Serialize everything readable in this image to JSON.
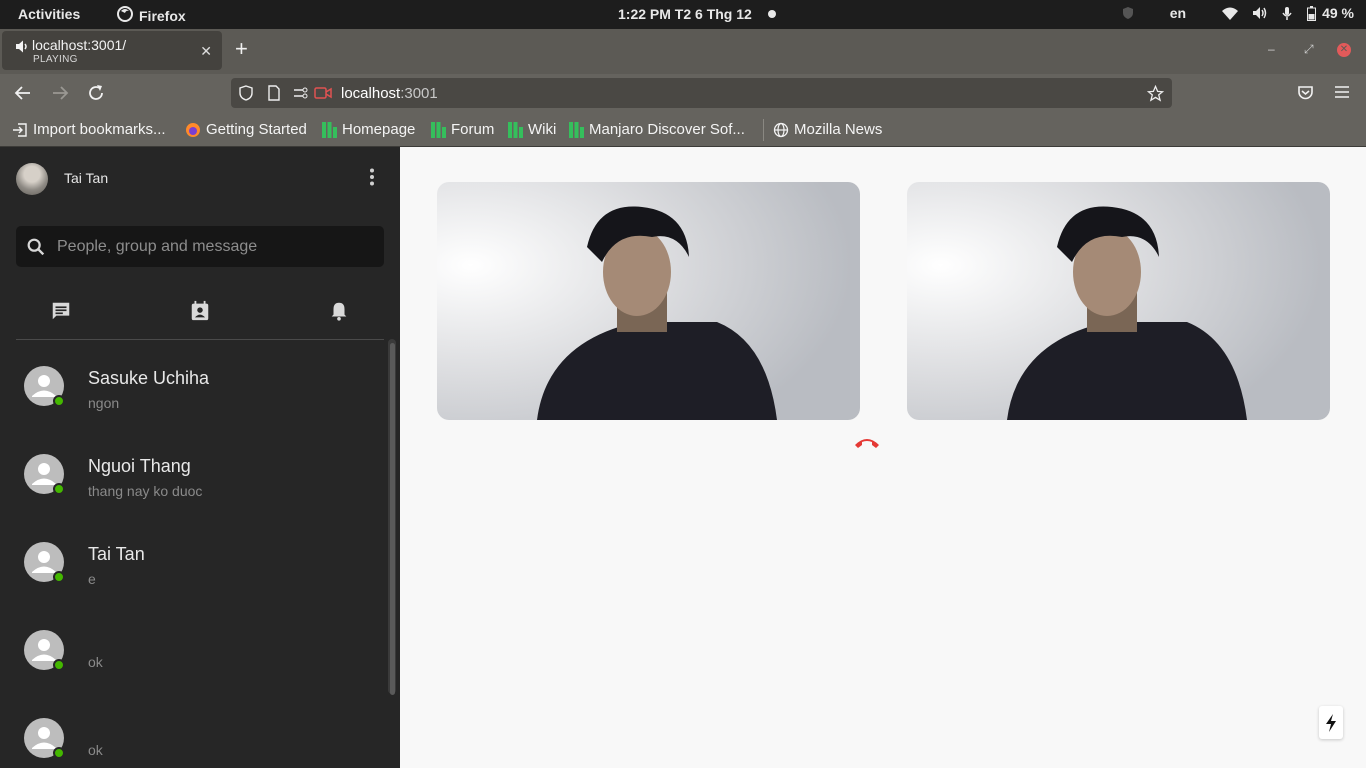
{
  "system_bar": {
    "activities": "Activities",
    "app_name": "Firefox",
    "clock": "1:22 PM  T2 6 Thg 12",
    "language": "en",
    "battery": "49 %"
  },
  "browser": {
    "tab": {
      "title": "localhost:3001/",
      "status": "PLAYING"
    },
    "url_host": "localhost",
    "url_port": ":3001",
    "bookmarks": [
      {
        "label": "Import bookmarks...",
        "icon": "import-icon"
      },
      {
        "label": "Getting Started",
        "icon": "firefox-icon"
      },
      {
        "label": "Homepage",
        "icon": "manjaro-icon"
      },
      {
        "label": "Forum",
        "icon": "manjaro-icon"
      },
      {
        "label": "Wiki",
        "icon": "manjaro-icon"
      },
      {
        "label": "Manjaro Discover Sof...",
        "icon": "manjaro-icon"
      },
      {
        "label": "Mozilla News",
        "icon": "globe-icon"
      }
    ]
  },
  "sidebar": {
    "user_name": "Tai Tan",
    "search_placeholder": "People, group and message",
    "tabs": [
      "chat-icon",
      "contacts-icon",
      "bell-icon"
    ],
    "conversations": [
      {
        "name": "Sasuke Uchiha",
        "last_message": "ngon"
      },
      {
        "name": "Nguoi Thang",
        "last_message": "thang nay ko duoc"
      },
      {
        "name": "Tai Tan",
        "last_message": "e"
      },
      {
        "name": "",
        "last_message": "ok"
      },
      {
        "name": "",
        "last_message": "ok"
      }
    ]
  },
  "call": {
    "videos": [
      "local-video",
      "remote-video"
    ],
    "hangup_color": "#e53935"
  }
}
